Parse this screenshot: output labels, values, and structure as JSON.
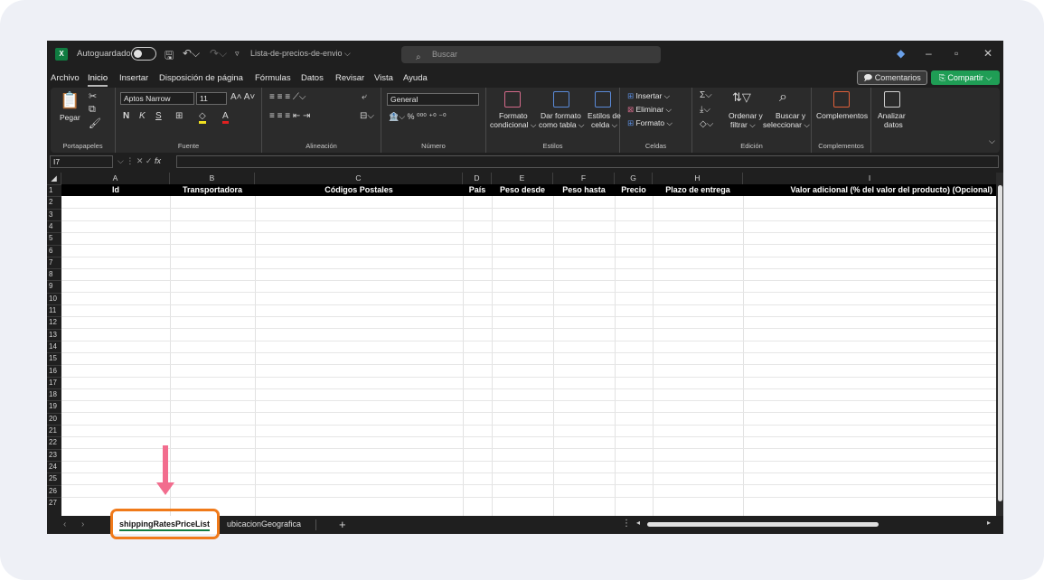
{
  "titlebar": {
    "app_badge": "X",
    "autosave_label": "Autoguardado",
    "filename": "Lista-de-precios-de-envio ⌵",
    "search_placeholder": "Buscar"
  },
  "menu": {
    "items": [
      "Archivo",
      "Inicio",
      "Insertar",
      "Disposición de página",
      "Fórmulas",
      "Datos",
      "Revisar",
      "Vista",
      "Ayuda"
    ],
    "active": "Inicio",
    "comments_label": "Comentarios",
    "share_label": "Compartir"
  },
  "ribbon": {
    "paste_label": "Pegar",
    "clipboard_group": "Portapapeles",
    "font_name": "Aptos Narrow",
    "font_size": "11",
    "font_group": "Fuente",
    "alignment_group": "Alineación",
    "number_format": "General",
    "number_group": "Número",
    "conditional_format_l1": "Formato",
    "conditional_format_l2": "condicional ⌵",
    "format_table_l1": "Dar formato",
    "format_table_l2": "como tabla ⌵",
    "cell_styles_l1": "Estilos de",
    "cell_styles_l2": "celda ⌵",
    "styles_group": "Estilos",
    "insert_label": "Insertar",
    "delete_label": "Eliminar",
    "format_label": "Formato",
    "cells_group": "Celdas",
    "sort_l1": "Ordenar y",
    "sort_l2": "filtrar ⌵",
    "find_l1": "Buscar y",
    "find_l2": "seleccionar ⌵",
    "editing_group": "Edición",
    "addins_label": "Complementos",
    "addins_group": "Complementos",
    "analyze_l1": "Analizar",
    "analyze_l2": "datos"
  },
  "formula_bar": {
    "name_box": "I7",
    "fx": "fx"
  },
  "grid": {
    "columns": [
      "A",
      "B",
      "C",
      "D",
      "E",
      "F",
      "G",
      "H",
      "I"
    ],
    "headers": [
      "Id",
      "Transportadora",
      "Códigos Postales",
      "País",
      "Peso desde",
      "Peso hasta",
      "Precio",
      "Plazo de entrega",
      "Valor adicional (% del valor del producto) (Opcional)"
    ],
    "row_numbers": [
      "1",
      "2",
      "3",
      "4",
      "5",
      "6",
      "7",
      "8",
      "9",
      "10",
      "11",
      "12",
      "13",
      "14",
      "15",
      "16",
      "17",
      "18",
      "19",
      "20",
      "21",
      "22",
      "23",
      "24",
      "25",
      "26",
      "27"
    ]
  },
  "sheets": {
    "tabs": [
      "shippingRatesPriceList",
      "ubicacionGeografica"
    ],
    "active": "shippingRatesPriceList",
    "add_label": "+"
  },
  "annotation": {
    "arrow_color": "#f26d8e",
    "highlight_color": "#f07a1a"
  }
}
